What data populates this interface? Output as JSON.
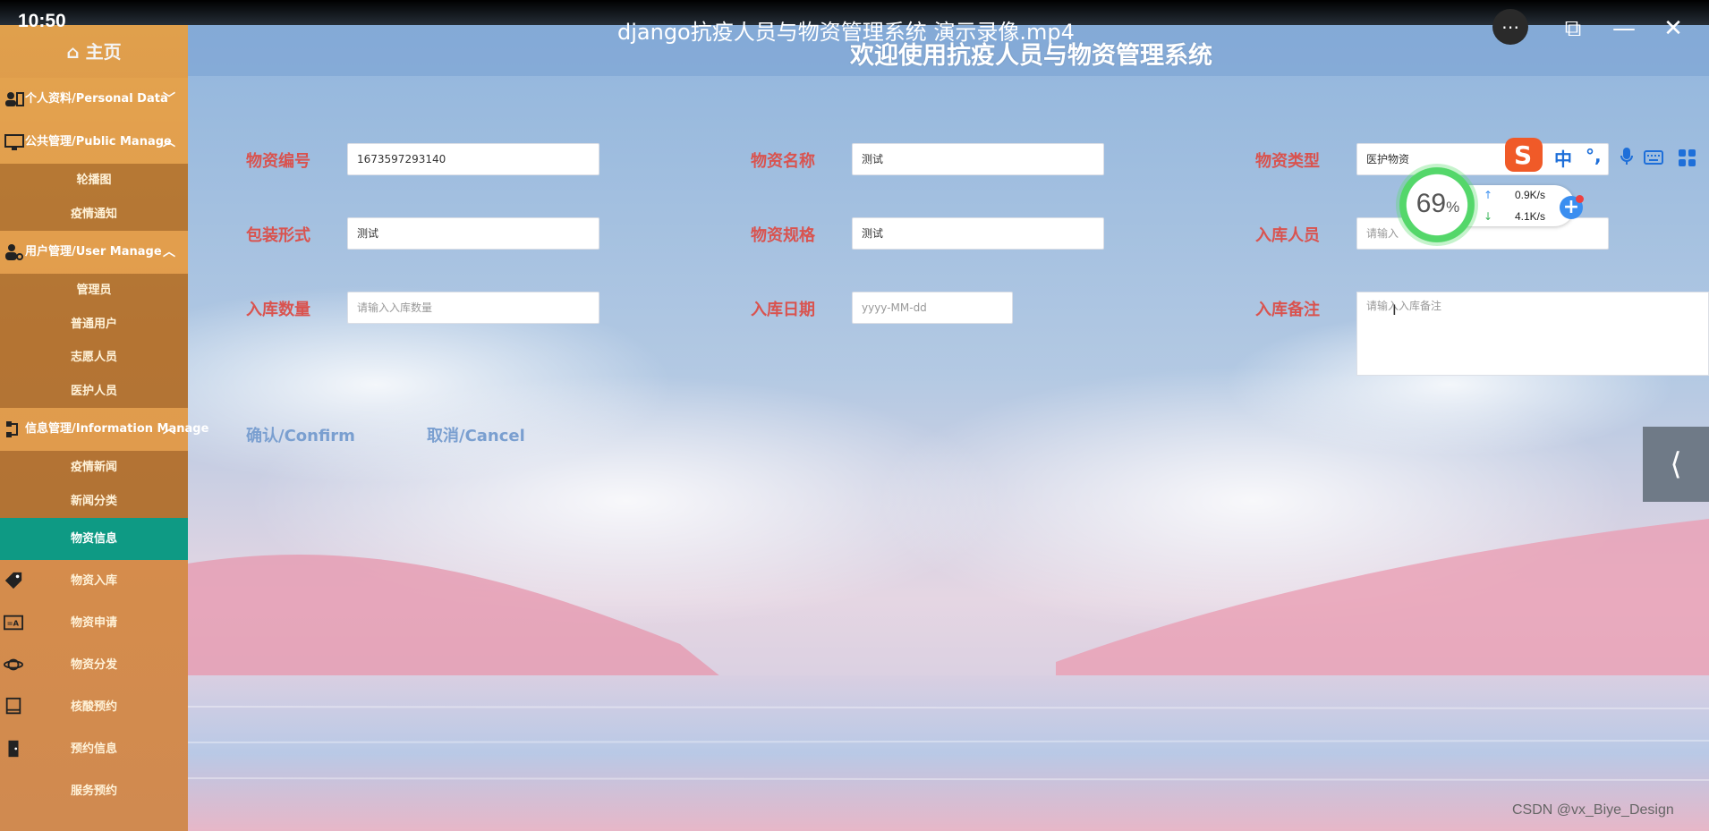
{
  "video": {
    "clock": "10:50",
    "title": "django抗疫人员与物资管理系统 演示录像.mp4",
    "controls": {
      "more": "⋯",
      "pip": "⧉",
      "minimize": "—",
      "close": "✕"
    }
  },
  "sidebar": {
    "home_label": "⌂ 主页",
    "groups": [
      {
        "label": "个人资料/Personal Data",
        "icon": "user-card-icon",
        "expanded": false,
        "items": []
      },
      {
        "label": "公共管理/Public Manage",
        "icon": "monitor-icon",
        "expanded": true,
        "items": [
          "轮播图",
          "疫情通知"
        ]
      },
      {
        "label": "用户管理/User Manage",
        "icon": "user-gear-icon",
        "expanded": true,
        "items": [
          "管理员",
          "普通用户",
          "志愿人员",
          "医护人员"
        ]
      },
      {
        "label": "信息管理/Information Manage",
        "icon": "flow-icon",
        "expanded": true,
        "items": [
          "疫情新闻",
          "新闻分类",
          "物资信息"
        ]
      }
    ],
    "active_item": "物资信息",
    "leaves": [
      {
        "label": "物资入库",
        "icon": "tag-icon"
      },
      {
        "label": "物资申请",
        "icon": "translate-icon"
      },
      {
        "label": "物资分发",
        "icon": "planet-icon"
      },
      {
        "label": "核酸预约",
        "icon": "book-icon"
      },
      {
        "label": "预约信息",
        "icon": "door-icon"
      },
      {
        "label": "服务预约",
        "icon": ""
      }
    ]
  },
  "page": {
    "title": "欢迎使用抗疫人员与物资管理系统"
  },
  "form": {
    "code_label": "物资编号",
    "code_value": "1673597293140",
    "name_label": "物资名称",
    "name_value": "测试",
    "type_label": "物资类型",
    "type_value": "医护物资",
    "pack_label": "包装形式",
    "pack_value": "测试",
    "spec_label": "物资规格",
    "spec_value": "测试",
    "person_label": "入库人员",
    "person_placeholder": "请输入",
    "qty_label": "入库数量",
    "qty_placeholder": "请输入入库数量",
    "date_label": "入库日期",
    "date_placeholder": "yyyy-MM-dd",
    "note_label": "入库备注",
    "note_placeholder": "请输入入库备注",
    "confirm_label": "确认/Confirm",
    "cancel_label": "取消/Cancel"
  },
  "ime": {
    "mode_label": "中",
    "punct_label": "°,",
    "mic_icon": "mic-icon",
    "keyboard_icon": "keyboard-icon",
    "apps_icon": "apps-icon"
  },
  "net_widget": {
    "percent": "69",
    "percent_sign": "%",
    "up_speed": "0.9K/s",
    "down_speed": "4.1K/s",
    "plus": "+"
  },
  "watermark": "CSDN @vx_Biye_Design",
  "colors": {
    "sidebar": "#d98e48",
    "active": "#0e9a84",
    "label": "#d9534f",
    "button": "#7a9fd0"
  }
}
